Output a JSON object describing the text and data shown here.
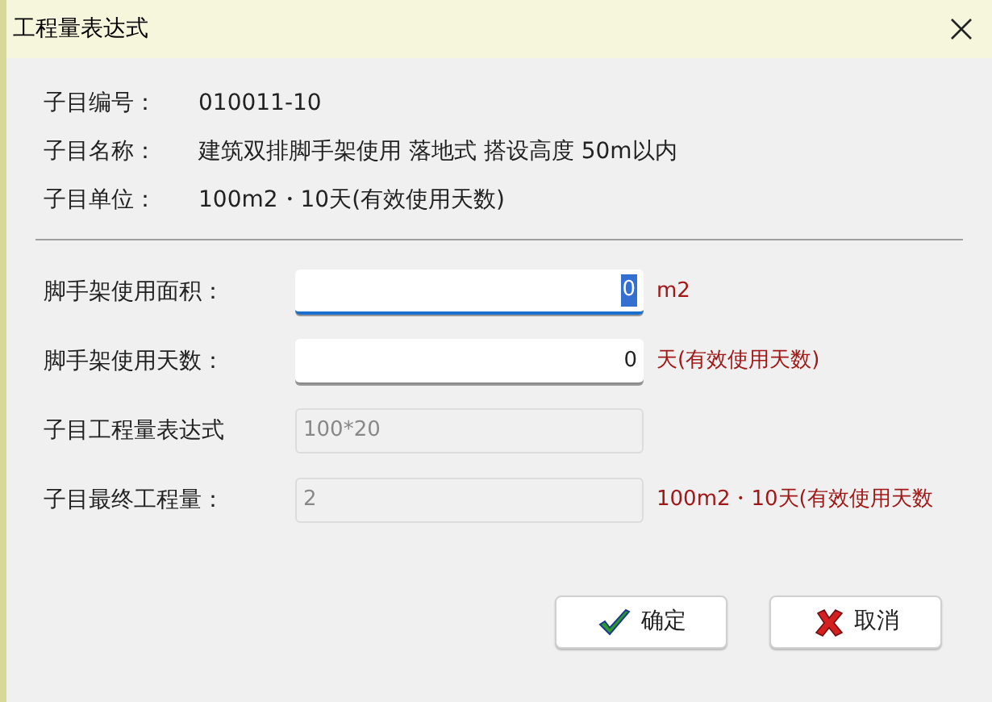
{
  "window": {
    "title": "工程量表达式"
  },
  "info": [
    {
      "label": "子目编号：",
      "value": "010011-10"
    },
    {
      "label": "子目名称：",
      "value": "建筑双排脚手架使用 落地式 搭设高度 50m以内"
    },
    {
      "label": "子目单位：",
      "value": "100m2・10天(有效使用天数)"
    }
  ],
  "fields": [
    {
      "label": "脚手架使用面积：",
      "value": "0",
      "unit": "m2",
      "disabled": false,
      "focused": true
    },
    {
      "label": "脚手架使用天数：",
      "value": "0",
      "unit": "天(有效使用天数)",
      "disabled": false,
      "focused": false
    },
    {
      "label": "子目工程量表达式",
      "value": "100*20",
      "disabled": true,
      "focused": false
    },
    {
      "label": "子目最终工程量：",
      "value": "2",
      "unit": "100m2・10天(有效使用天数",
      "disabled": true,
      "focused": false
    }
  ],
  "buttons": [
    {
      "kind": "ok",
      "label": "确定"
    },
    {
      "kind": "cancel",
      "label": "取消"
    }
  ]
}
